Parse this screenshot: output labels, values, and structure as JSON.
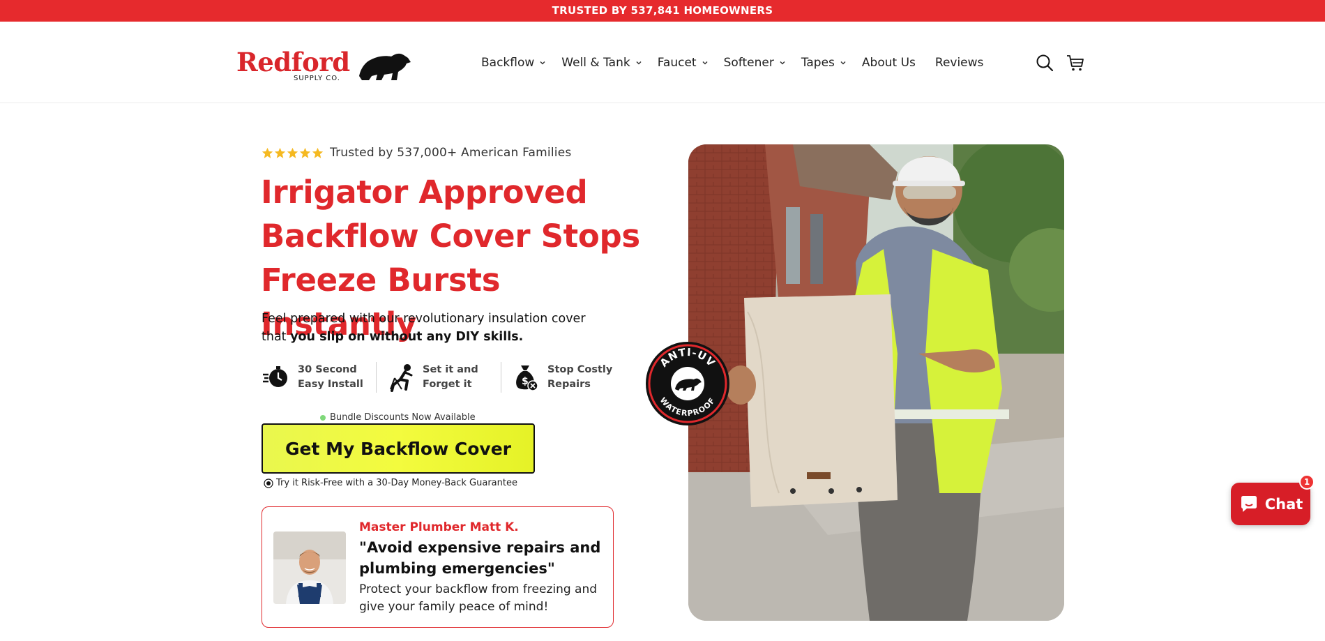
{
  "announcement": {
    "text": "TRUSTED BY 537,841 HOMEOWNERS"
  },
  "brand": {
    "name": "Redford",
    "tagline": "SUPPLY CO."
  },
  "nav": {
    "items": [
      {
        "label": "Backflow",
        "has_dropdown": true
      },
      {
        "label": "Well & Tank",
        "has_dropdown": true
      },
      {
        "label": "Faucet",
        "has_dropdown": true
      },
      {
        "label": "Softener",
        "has_dropdown": true
      },
      {
        "label": "Tapes",
        "has_dropdown": true
      },
      {
        "label": "About Us",
        "has_dropdown": false
      },
      {
        "label": "Reviews",
        "has_dropdown": false
      }
    ],
    "icons": [
      "search-icon",
      "cart-icon"
    ]
  },
  "hero": {
    "rating_text": "Trusted by 537,000+ American Families",
    "stars": 5,
    "headline": "Irrigator Approved Backflow Cover Stops Freeze Bursts Instantly",
    "subcopy_plain": "Feel prepared with our revolutionary insulation cover that ",
    "subcopy_bold": "you slip on without any DIY skills.",
    "features": [
      {
        "icon": "stopwatch-icon",
        "label": "30 Second Easy Install"
      },
      {
        "icon": "relaxing-person-icon",
        "label": "Set it and Forget it"
      },
      {
        "icon": "money-bag-icon",
        "label": "Stop Costly Repairs"
      }
    ],
    "bundle_note": "Bundle Discounts Now Available",
    "cta_label": "Get My Backflow Cover",
    "guarantee": "Try it Risk-Free with a 30-Day Money-Back Guarantee",
    "badge_top": "ANTI-UV",
    "badge_bottom": "WATERPROOF"
  },
  "testimonial": {
    "name": "Master Plumber Matt K.",
    "quote": "\"Avoid expensive repairs and plumbing emergencies\"",
    "body": "Protect your backflow from freezing and give your family peace of mind!"
  },
  "chat": {
    "label": "Chat",
    "unread": "1"
  },
  "colors": {
    "brand_red": "#e0282c",
    "cta_yellow": "#eef743",
    "topbar_red": "#e62a2d"
  }
}
